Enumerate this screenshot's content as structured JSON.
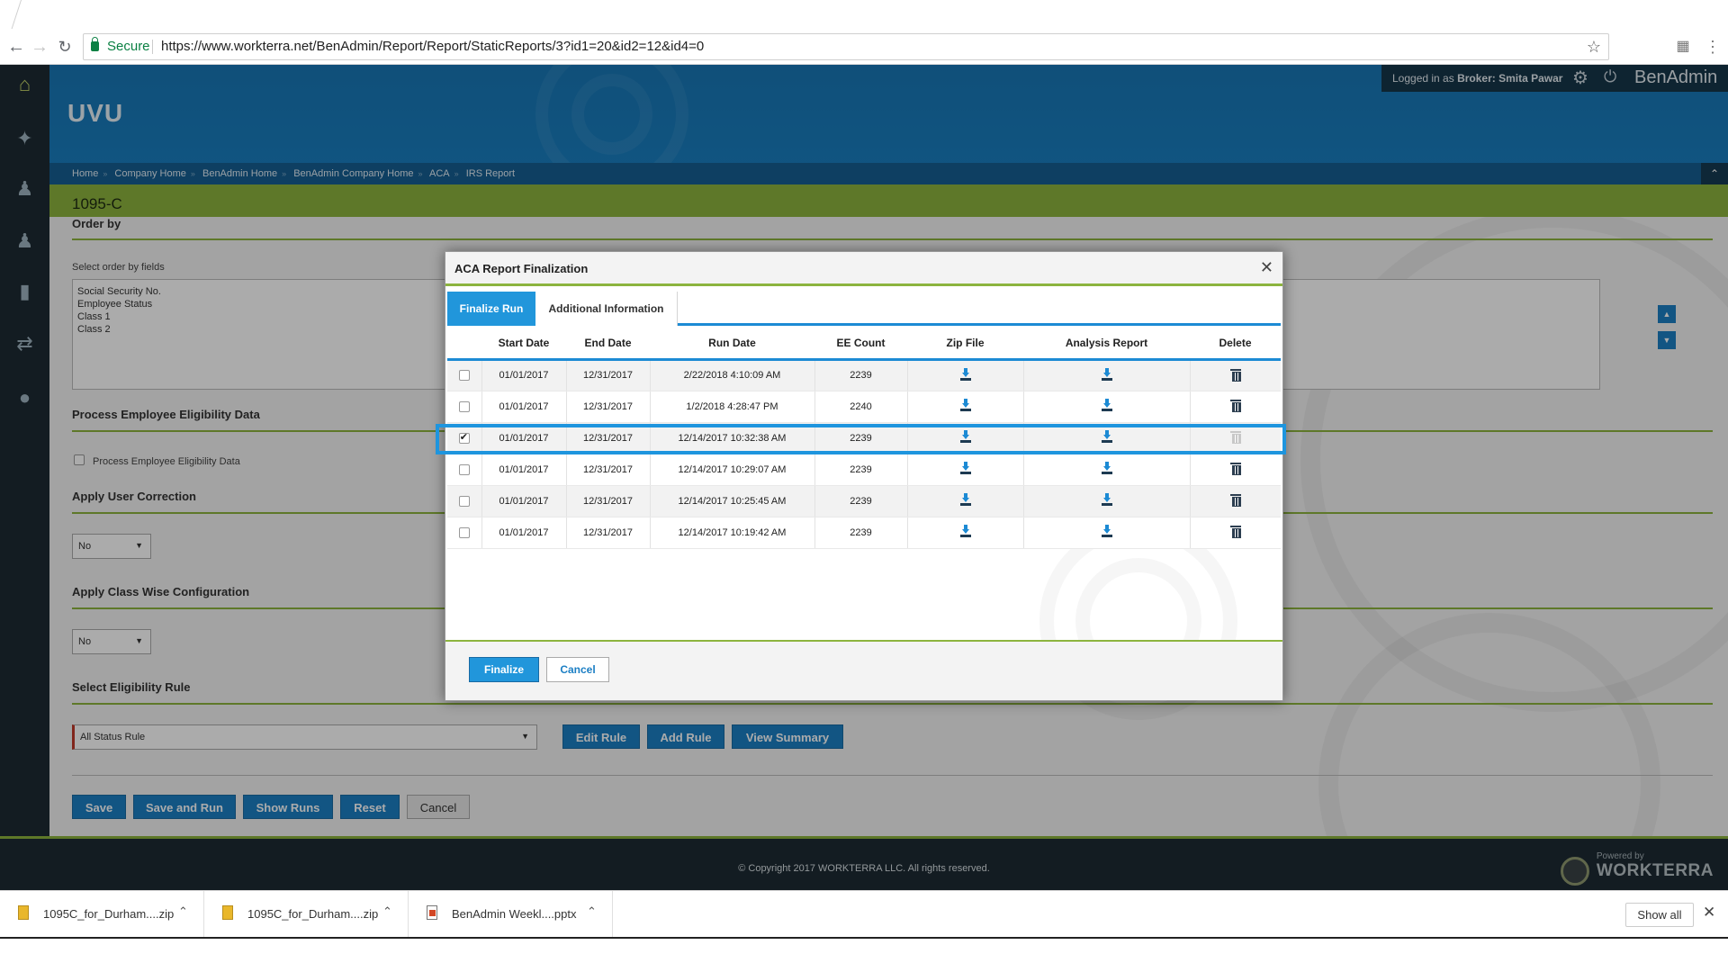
{
  "browser": {
    "secure_label": "Secure",
    "url": "https://www.workterra.net/BenAdmin/Report/Report/StaticReports/3?id1=20&id2=12&id4=0"
  },
  "header": {
    "brand": "UVU",
    "logged_prefix": "Logged in as",
    "role": "Broker:",
    "user": "Smita Pawar",
    "app_name": "BenAdmin"
  },
  "breadcrumb": [
    "Home",
    "Company Home",
    "BenAdmin Home",
    "BenAdmin Company Home",
    "ACA",
    "IRS Report"
  ],
  "page": {
    "title": "1095-C",
    "order_by_title": "Order by",
    "order_by_label": "Select order by fields",
    "order_fields": [
      "Social Security No.",
      "Employee Status",
      "Class 1",
      "Class 2"
    ],
    "process_title": "Process Employee Eligibility Data",
    "process_checkbox_label": "Process Employee Eligibility Data",
    "user_correction_title": "Apply User Correction",
    "user_correction_value": "No",
    "class_config_title": "Apply Class Wise Configuration",
    "class_config_value": "No",
    "eligibility_title": "Select Eligibility Rule",
    "eligibility_value": "All Status Rule",
    "rule_buttons": {
      "edit": "Edit Rule",
      "add": "Add Rule",
      "summary": "View Summary"
    },
    "buttons": {
      "save": "Save",
      "save_run": "Save and Run",
      "show_runs": "Show Runs",
      "reset": "Reset",
      "cancel": "Cancel"
    }
  },
  "footer": {
    "copyright": "© Copyright 2017 WORKTERRA LLC. All rights reserved.",
    "powered_small": "Powered by",
    "powered_big": "WORKTERRA"
  },
  "modal": {
    "title": "ACA Report Finalization",
    "tabs": [
      "Finalize Run",
      "Additional Information"
    ],
    "columns": [
      "",
      "Start Date",
      "End Date",
      "Run Date",
      "EE Count",
      "Zip File",
      "Analysis Report",
      "Delete"
    ],
    "rows": [
      {
        "checked": false,
        "start": "01/01/2017",
        "end": "12/31/2017",
        "run": "2/22/2018 4:10:09 AM",
        "count": "2239",
        "delete_enabled": true
      },
      {
        "checked": false,
        "start": "01/01/2017",
        "end": "12/31/2017",
        "run": "1/2/2018 4:28:47 PM",
        "count": "2240",
        "delete_enabled": true
      },
      {
        "checked": true,
        "start": "01/01/2017",
        "end": "12/31/2017",
        "run": "12/14/2017 10:32:38 AM",
        "count": "2239",
        "delete_enabled": false
      },
      {
        "checked": false,
        "start": "01/01/2017",
        "end": "12/31/2017",
        "run": "12/14/2017 10:29:07 AM",
        "count": "2239",
        "delete_enabled": true
      },
      {
        "checked": false,
        "start": "01/01/2017",
        "end": "12/31/2017",
        "run": "12/14/2017 10:25:45 AM",
        "count": "2239",
        "delete_enabled": true
      },
      {
        "checked": false,
        "start": "01/01/2017",
        "end": "12/31/2017",
        "run": "12/14/2017 10:19:42 AM",
        "count": "2239",
        "delete_enabled": true
      }
    ],
    "finalize_label": "Finalize",
    "cancel_label": "Cancel"
  },
  "downloads": {
    "items": [
      "1095C_for_Durham....zip",
      "1095C_for_Durham....zip",
      "BenAdmin Weekl....pptx"
    ],
    "show_all": "Show all"
  },
  "colors": {
    "accent_blue": "#1c8ad4",
    "accent_green": "#8cb43e",
    "highlight": "#1e95de"
  }
}
